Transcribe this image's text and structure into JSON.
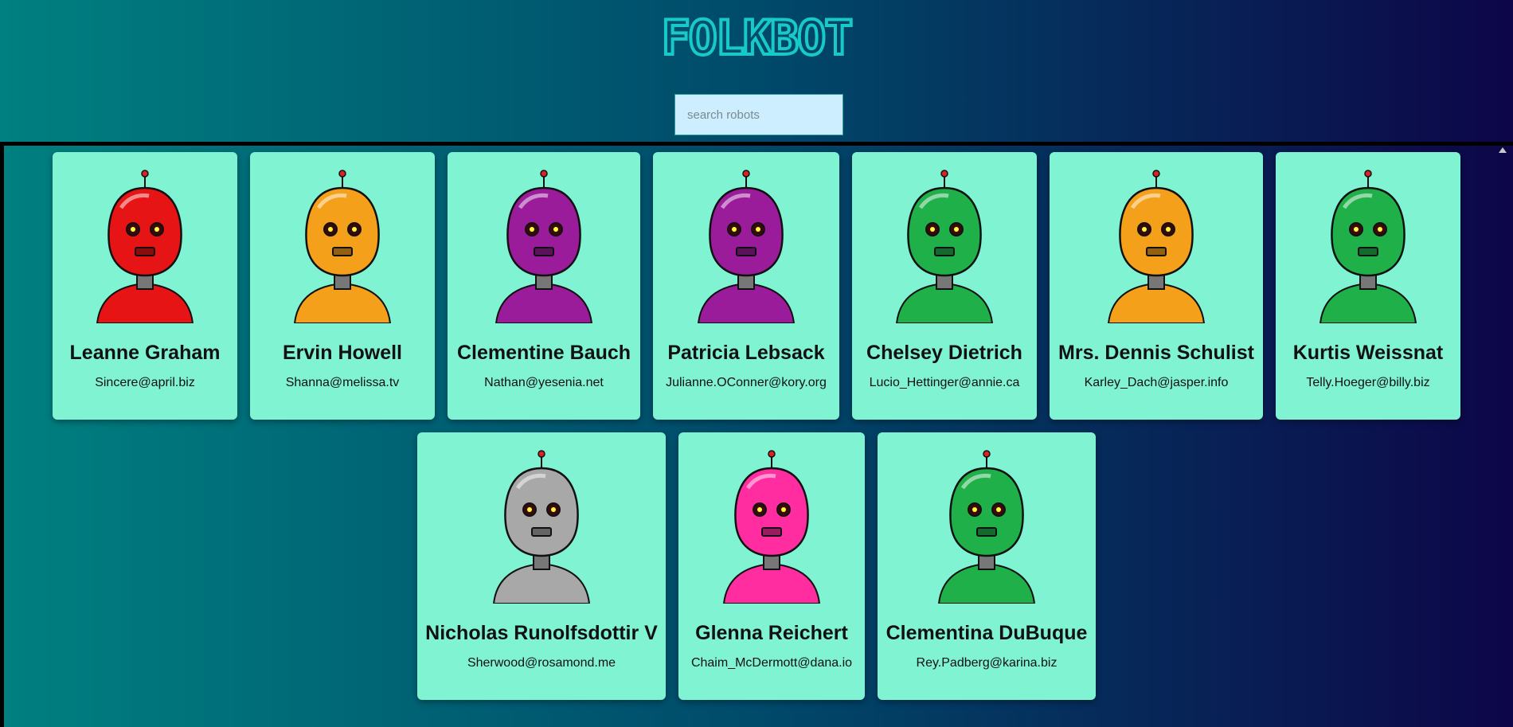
{
  "logo": {
    "text": "FOLKBOT",
    "color": "#17c9c9"
  },
  "search": {
    "placeholder": "search robots",
    "value": ""
  },
  "colors": {
    "card": "#80f3d3",
    "divider": "#000000"
  },
  "robots": [
    {
      "name": "Leanne Graham",
      "email": "Sincere@april.biz",
      "color": "#e61414"
    },
    {
      "name": "Ervin Howell",
      "email": "Shanna@melissa.tv",
      "color": "#f4a01a"
    },
    {
      "name": "Clementine Bauch",
      "email": "Nathan@yesenia.net",
      "color": "#9a1c9a"
    },
    {
      "name": "Patricia Lebsack",
      "email": "Julianne.OConner@kory.org",
      "color": "#9a1c9a"
    },
    {
      "name": "Chelsey Dietrich",
      "email": "Lucio_Hettinger@annie.ca",
      "color": "#20b04a"
    },
    {
      "name": "Mrs. Dennis Schulist",
      "email": "Karley_Dach@jasper.info",
      "color": "#f4a01a"
    },
    {
      "name": "Kurtis Weissnat",
      "email": "Telly.Hoeger@billy.biz",
      "color": "#20b04a"
    },
    {
      "name": "Nicholas Runolfsdottir V",
      "email": "Sherwood@rosamond.me",
      "color": "#a8a8a8"
    },
    {
      "name": "Glenna Reichert",
      "email": "Chaim_McDermott@dana.io",
      "color": "#ff2da0"
    },
    {
      "name": "Clementina DuBuque",
      "email": "Rey.Padberg@karina.biz",
      "color": "#20b04a"
    }
  ]
}
